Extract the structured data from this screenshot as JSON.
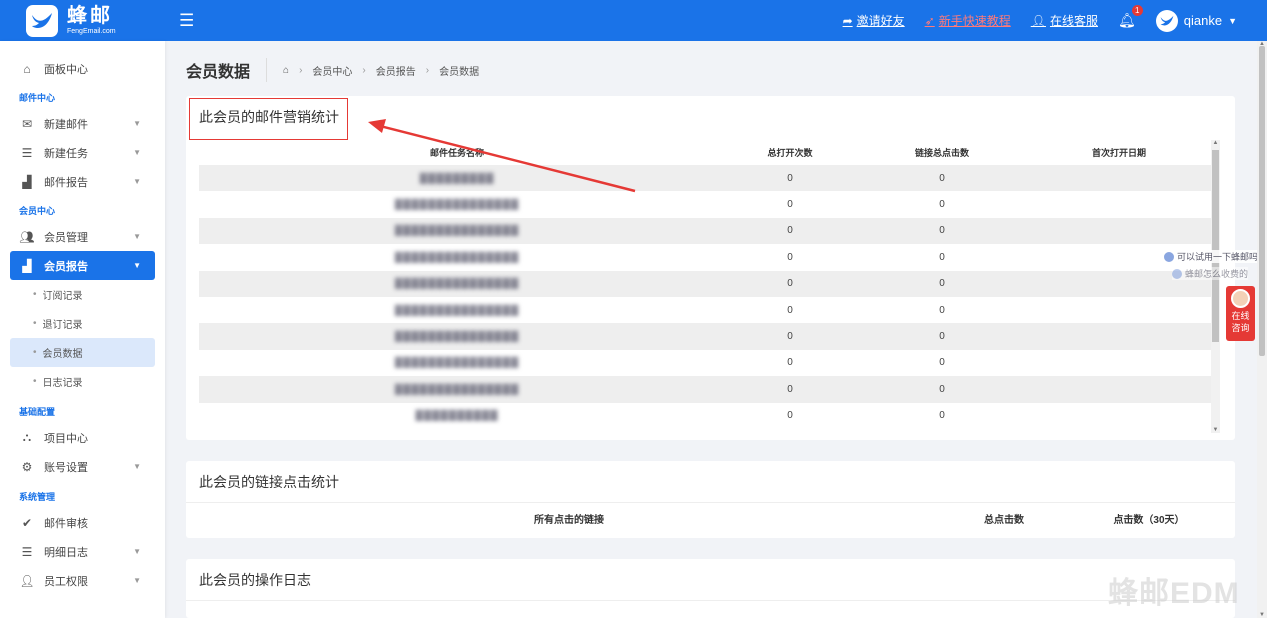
{
  "brand": {
    "name": "蜂邮",
    "domain": "FengEmail.com"
  },
  "topbar": {
    "invite": "邀请好友",
    "tutorial": "新手快速教程",
    "support": "在线客服",
    "notifications": "1",
    "username": "qianke"
  },
  "sidebar": {
    "dashboard": "面板中心",
    "sections": {
      "mail_center": "邮件中心",
      "member_center": "会员中心",
      "base_config": "基础配置",
      "system": "系统管理"
    },
    "items": {
      "new_mail": "新建邮件",
      "new_task": "新建任务",
      "mail_report": "邮件报告",
      "member_manage": "会员管理",
      "member_report": "会员报告",
      "subscribe_log": "订阅记录",
      "unsubscribe_log": "退订记录",
      "member_data": "会员数据",
      "log_records": "日志记录",
      "project_center": "项目中心",
      "account_settings": "账号设置",
      "mail_review": "邮件审核",
      "detail_log": "明细日志",
      "staff_permissions": "员工权限"
    }
  },
  "page": {
    "title": "会员数据",
    "breadcrumb": [
      "会员中心",
      "会员报告",
      "会员数据"
    ]
  },
  "card1": {
    "title": "此会员的邮件营销统计",
    "columns": [
      "邮件任务名称",
      "总打开次数",
      "链接总点击数",
      "首次打开日期"
    ],
    "rows": [
      {
        "name": "▓▓▓▓▓▓▓▓▓",
        "opens": "0",
        "clicks": "0",
        "first_open": ""
      },
      {
        "name": "▓▓▓▓▓▓▓▓▓▓▓▓▓▓▓",
        "opens": "0",
        "clicks": "0",
        "first_open": ""
      },
      {
        "name": "▓▓▓▓▓▓▓▓▓▓▓▓▓▓▓",
        "opens": "0",
        "clicks": "0",
        "first_open": ""
      },
      {
        "name": "▓▓▓▓▓▓▓▓▓▓▓▓▓▓▓",
        "opens": "0",
        "clicks": "0",
        "first_open": ""
      },
      {
        "name": "▓▓▓▓▓▓▓▓▓▓▓▓▓▓▓",
        "opens": "0",
        "clicks": "0",
        "first_open": ""
      },
      {
        "name": "▓▓▓▓▓▓▓▓▓▓▓▓▓▓▓",
        "opens": "0",
        "clicks": "0",
        "first_open": ""
      },
      {
        "name": "▓▓▓▓▓▓▓▓▓▓▓▓▓▓▓",
        "opens": "0",
        "clicks": "0",
        "first_open": ""
      },
      {
        "name": "▓▓▓▓▓▓▓▓▓▓▓▓▓▓▓",
        "opens": "0",
        "clicks": "0",
        "first_open": ""
      },
      {
        "name": "▓▓▓▓▓▓▓▓▓▓▓▓▓▓▓",
        "opens": "0",
        "clicks": "0",
        "first_open": ""
      },
      {
        "name": "▓▓▓▓▓▓▓▓▓▓",
        "opens": "0",
        "clicks": "0",
        "first_open": ""
      }
    ]
  },
  "card2": {
    "title": "此会员的链接点击统计",
    "columns": [
      "所有点击的链接",
      "总点击数",
      "点击数（30天）"
    ]
  },
  "card3": {
    "title": "此会员的操作日志"
  },
  "floats": {
    "tip1": "可以试用一下蜂邮吗",
    "tip2": "蜂邮怎么收费的",
    "chat": "在线咨询",
    "watermark": "蜂邮EDM"
  },
  "colors": {
    "primary": "#1a73e8",
    "alert": "#e53935"
  },
  "icons": [
    "bars-icon",
    "share-icon",
    "rocket-icon",
    "user-icon",
    "bell-icon",
    "home-icon"
  ]
}
